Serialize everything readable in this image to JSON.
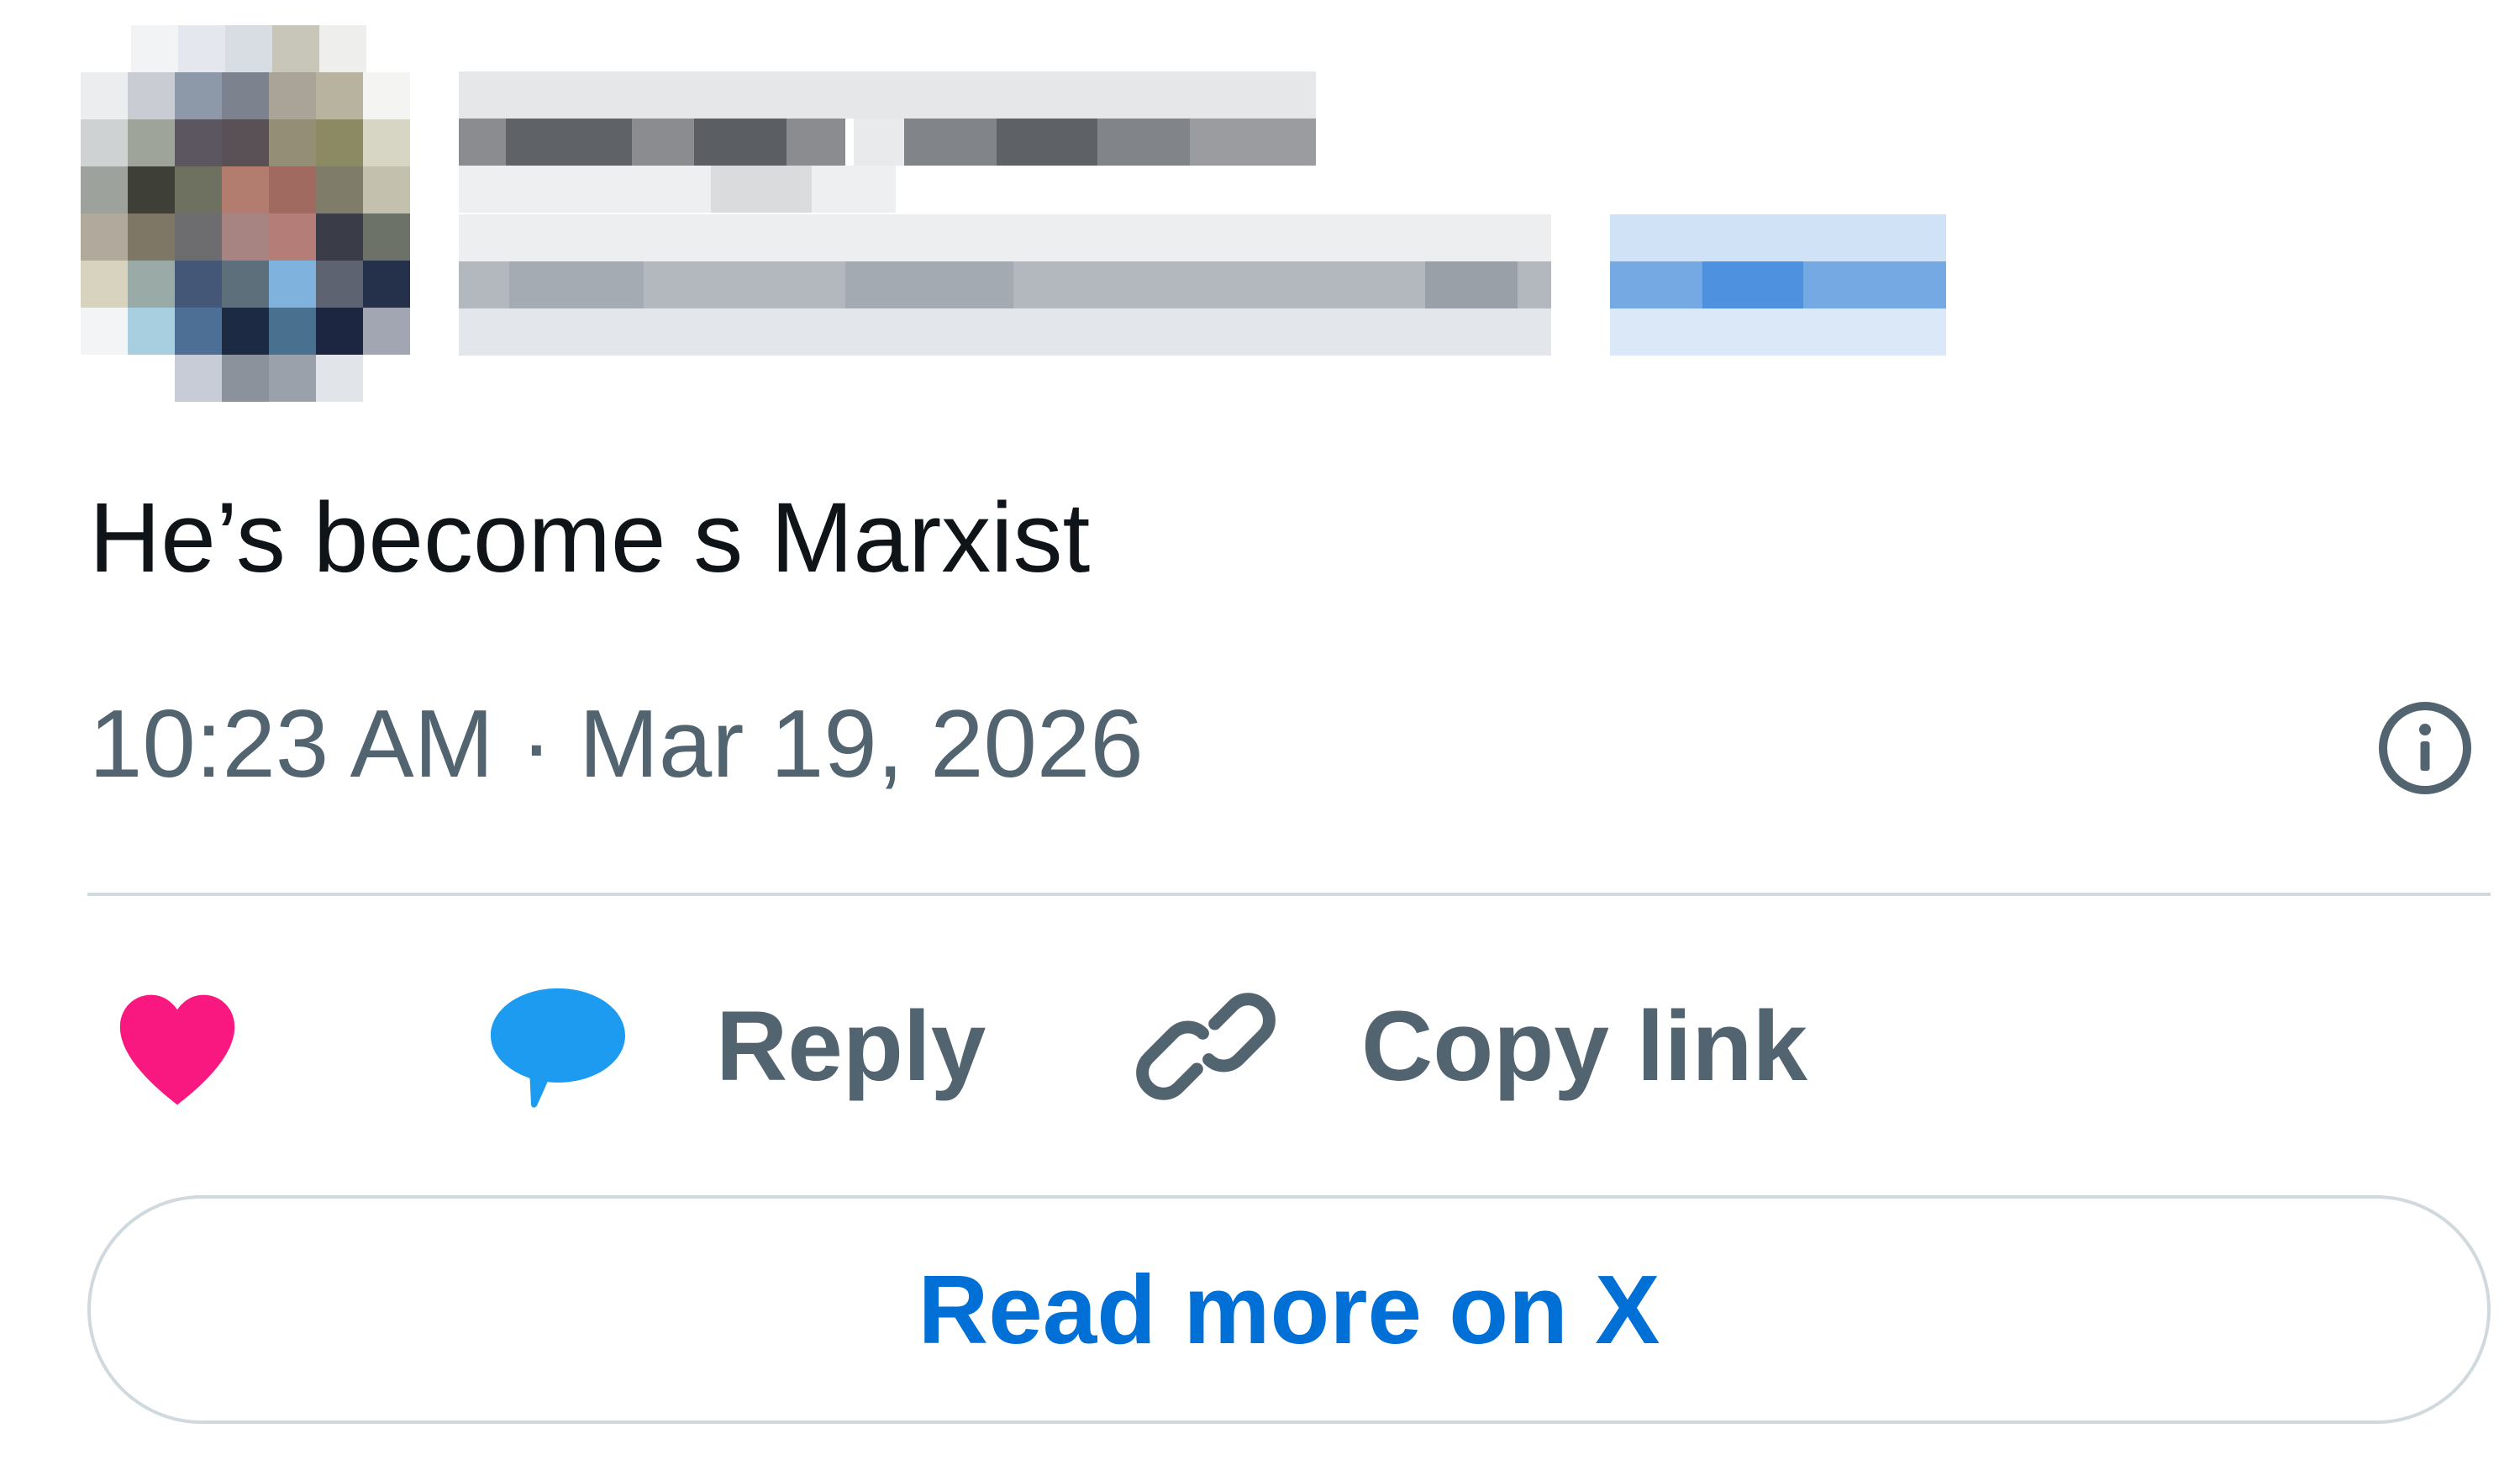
{
  "tweet": {
    "text": "He’s become s Marxist",
    "timestamp": "10:23 AM · Mar 19, 2026"
  },
  "actions": {
    "like_icon": "heart-icon",
    "reply_icon": "speech-bubble-icon",
    "reply_label": "Reply",
    "copy_icon": "link-icon",
    "copy_label": "Copy link"
  },
  "info_icon": "info-icon",
  "read_more": {
    "label": "Read more on X"
  },
  "colors": {
    "text": "#0f1419",
    "muted": "#536471",
    "like": "#f91880",
    "reply": "#1d9bf0",
    "link": "#006fd6",
    "border": "#cfd9de"
  }
}
